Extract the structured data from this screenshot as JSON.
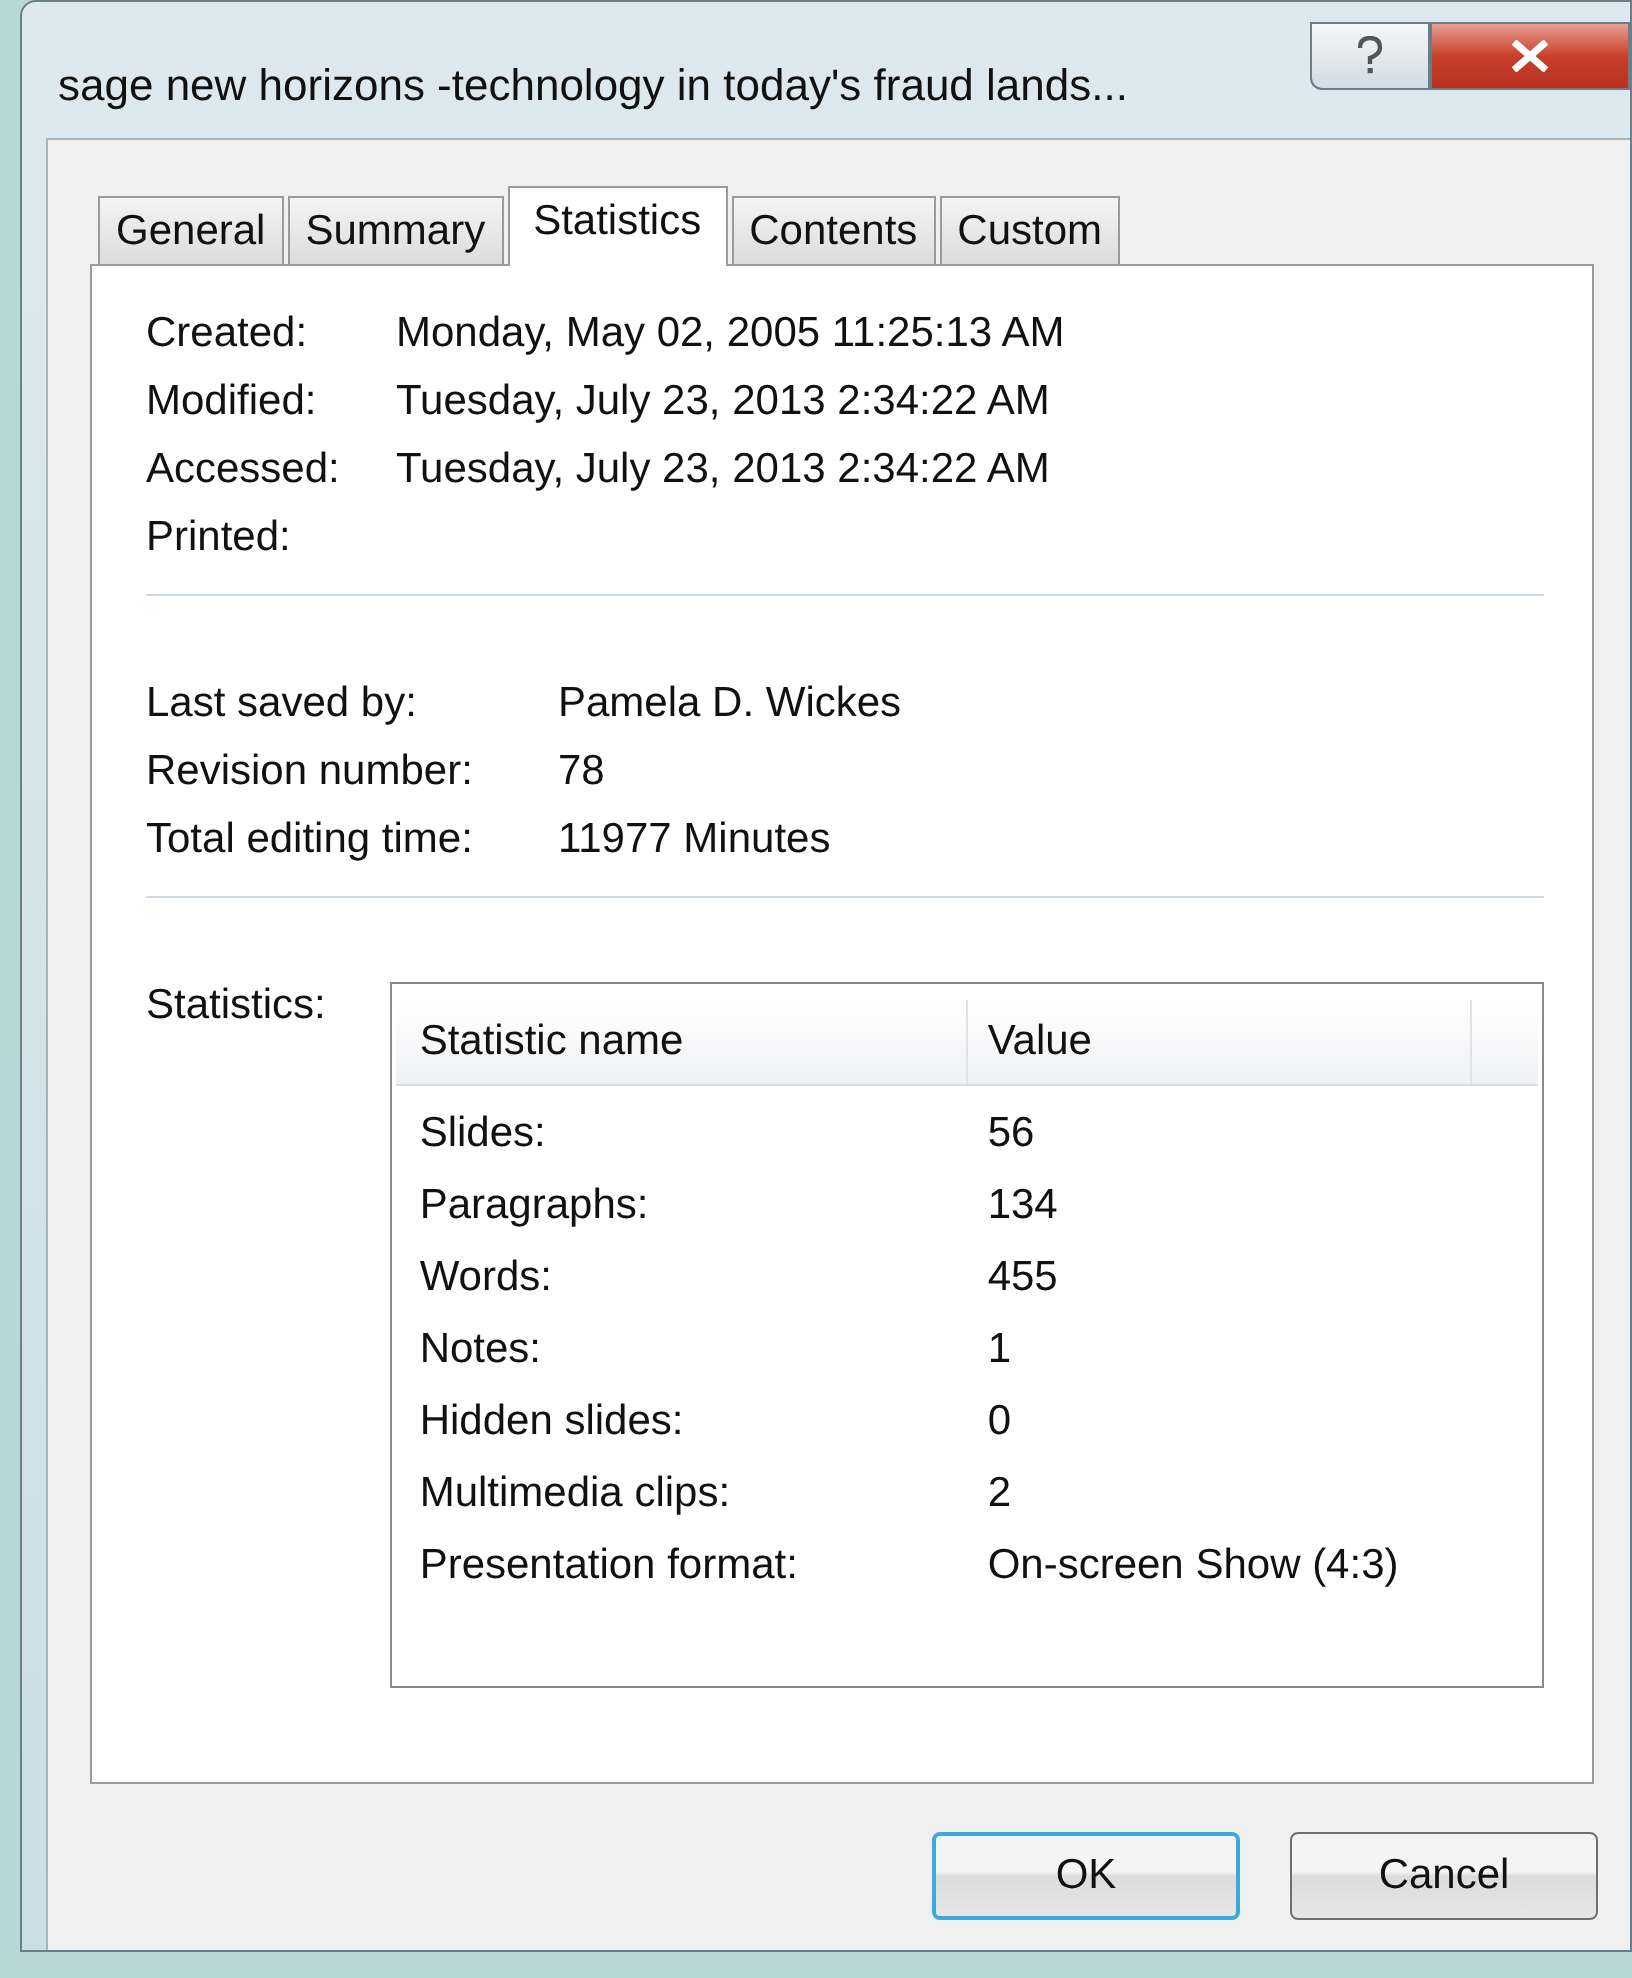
{
  "window": {
    "title": "sage new horizons -technology in today's fraud lands..."
  },
  "tabs": [
    {
      "label": "General",
      "selected": false
    },
    {
      "label": "Summary",
      "selected": false
    },
    {
      "label": "Statistics",
      "selected": true
    },
    {
      "label": "Contents",
      "selected": false
    },
    {
      "label": "Custom",
      "selected": false
    }
  ],
  "dates": [
    {
      "label": "Created:",
      "value": "Monday, May 02, 2005 11:25:13 AM"
    },
    {
      "label": "Modified:",
      "value": "Tuesday, July 23, 2013 2:34:22 AM"
    },
    {
      "label": "Accessed:",
      "value": "Tuesday, July 23, 2013 2:34:22 AM"
    },
    {
      "label": "Printed:"
    }
  ],
  "info": [
    {
      "label": "Last saved by:",
      "value": "Pamela D. Wickes"
    },
    {
      "label": "Revision number:",
      "value": "78"
    },
    {
      "label": "Total editing time:",
      "value": "11977 Minutes"
    }
  ],
  "statistics": {
    "label": "Statistics:",
    "columns": [
      "Statistic name",
      "Value"
    ],
    "rows": [
      {
        "name": "Slides:",
        "value": "56"
      },
      {
        "name": "Paragraphs:",
        "value": "134"
      },
      {
        "name": "Words:",
        "value": "455"
      },
      {
        "name": "Notes:",
        "value": "1"
      },
      {
        "name": "Hidden slides:",
        "value": "0"
      },
      {
        "name": "Multimedia clips:",
        "value": "2"
      },
      {
        "name": "Presentation format:",
        "value": "On-screen Show (4:3)"
      }
    ]
  },
  "buttons": [
    {
      "label": "OK",
      "default": true
    },
    {
      "label": "Cancel",
      "default": false
    }
  ]
}
